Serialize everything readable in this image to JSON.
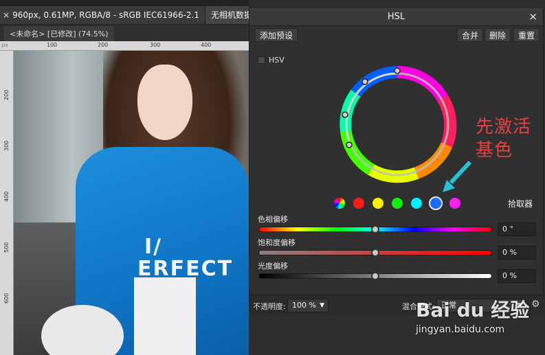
{
  "top_tab": {
    "close_glyph": "×",
    "info": "960px, 0.61MP, RGBA/8 - sRGB IEC61966-2.1",
    "exif_tab": "无相机数据"
  },
  "document": {
    "tab_label": "<未命名> [已修改] (74.5%)"
  },
  "ruler": {
    "unit": "px",
    "h_ticks": [
      "100",
      "200",
      "300",
      "400"
    ],
    "v_ticks": [
      "200",
      "300",
      "400",
      "500",
      "600"
    ]
  },
  "photo": {
    "shirt_text_line1": "I/",
    "shirt_text_line2": "ERFECT",
    "shirt_color": "#1488d8"
  },
  "hsl_panel": {
    "title": "HSL",
    "close_glyph": "×",
    "add_preset": "添加预设",
    "merge": "合并",
    "delete": "删除",
    "reset": "重置",
    "hsv_label": "HSV",
    "hsv_checked": false,
    "base_colors": [
      "#master-wheel",
      "#ff0000",
      "#ffff00",
      "#00ff00",
      "#00ffff",
      "#0000ff",
      "#ff00ff"
    ],
    "selected_base_color": "blue",
    "picker_label": "拾取器",
    "hue_label": "色相偏移",
    "hue_value": "0 °",
    "hue_position": 0.5,
    "saturation_label": "饱和度偏移",
    "saturation_value": "0 %",
    "saturation_position": 0.5,
    "lightness_label": "光度偏移",
    "lightness_value": "0 %",
    "lightness_position": 0.5,
    "opacity_label": "不透明度:",
    "opacity_value": "100 %",
    "blend_label": "混合模式:",
    "blend_value": "正常"
  },
  "annotation": {
    "line1": "先激活",
    "line2": "基色",
    "color": "#e8403e"
  },
  "watermark": {
    "logo": "Bai du 经验",
    "url": "jingyan.baidu.com"
  },
  "colors": {
    "panel_bg": "#303030",
    "accent_annotation": "#e8403e",
    "arrow": "#2bc0d4"
  }
}
